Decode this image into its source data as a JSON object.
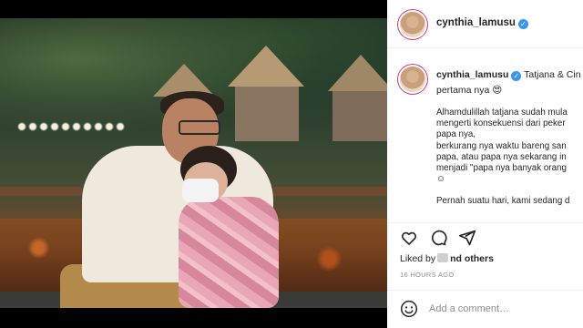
{
  "post": {
    "username": "cynthia_lamusu",
    "verified_symbol": "✓",
    "caption_intro": {
      "username": "cynthia_lamusu",
      "text_line1": "Tatjana & Cin",
      "text_line2": "pertama nya 😍"
    },
    "caption_lines": [
      "Alhamdulillah tatjana sudah mula",
      "mengerti konsekuensi dari peker",
      "papa nya,",
      "berkurang nya waktu bareng san",
      "papa, atau papa nya sekarang in",
      "menjadi \"papa nya banyak orang",
      "☺",
      "",
      "Pernah suatu hari, kami sedang d"
    ],
    "likes": {
      "prefix": "Liked by",
      "suffix": "nd others"
    },
    "timestamp": "16 HOURS AGO"
  },
  "actions": {
    "like_icon": "heart-icon",
    "comment_icon": "comment-icon",
    "share_icon": "share-icon"
  },
  "comment": {
    "placeholder": "Add a comment…",
    "emoji_icon": "smiley-icon"
  },
  "colors": {
    "verified": "#3897f0",
    "avatar_ring": "#d63b6f",
    "muted_text": "#8e8e8e",
    "primary_text": "#262626"
  }
}
